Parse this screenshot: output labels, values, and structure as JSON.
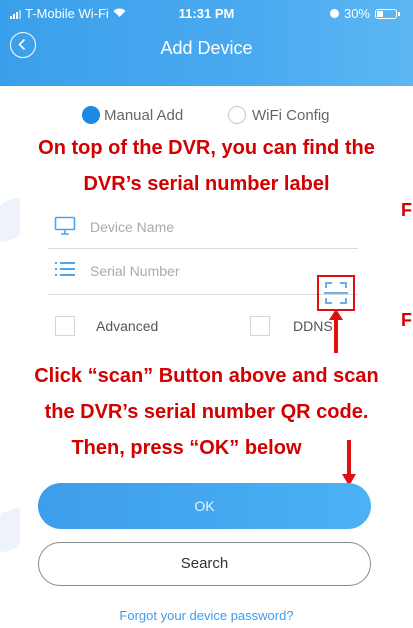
{
  "status_bar": {
    "carrier": "T-Mobile Wi-Fi",
    "time": "11:31 PM",
    "battery": "30%"
  },
  "header": {
    "title": "Add Device"
  },
  "modes": [
    {
      "label": "Manual Add",
      "selected": true
    },
    {
      "label": "WiFi Config",
      "selected": false
    }
  ],
  "fields": {
    "device_name_placeholder": "Device Name",
    "serial_number_placeholder": "Serial Number"
  },
  "options": {
    "advanced_label": "Advanced",
    "advanced_checked": false,
    "ddns_label": "DDNS",
    "ddns_checked": false
  },
  "annotations": {
    "top_line1": "On top of the DVR, you can find the",
    "top_line2": "DVR’s serial number label",
    "bottom_line1": "Click “scan” Button above and scan",
    "bottom_line2": "the DVR’s serial number QR code.",
    "bottom_line3": "Then, press “OK” below",
    "edge_char_1": "F",
    "edge_char_2": "F"
  },
  "buttons": {
    "ok": "OK",
    "search": "Search",
    "forgot": "Forgot your device password?"
  },
  "colors": {
    "header_blue": "#3a9fea",
    "annotation_red": "#d40000",
    "radio_blue": "#1e88e5",
    "link_blue": "#3d9deb"
  },
  "icons": [
    "signal-icon",
    "wifi-icon",
    "battery-icon",
    "back-icon",
    "monitor-icon",
    "list-icon",
    "scan-icon",
    "arrow-up-icon",
    "arrow-down-icon"
  ]
}
